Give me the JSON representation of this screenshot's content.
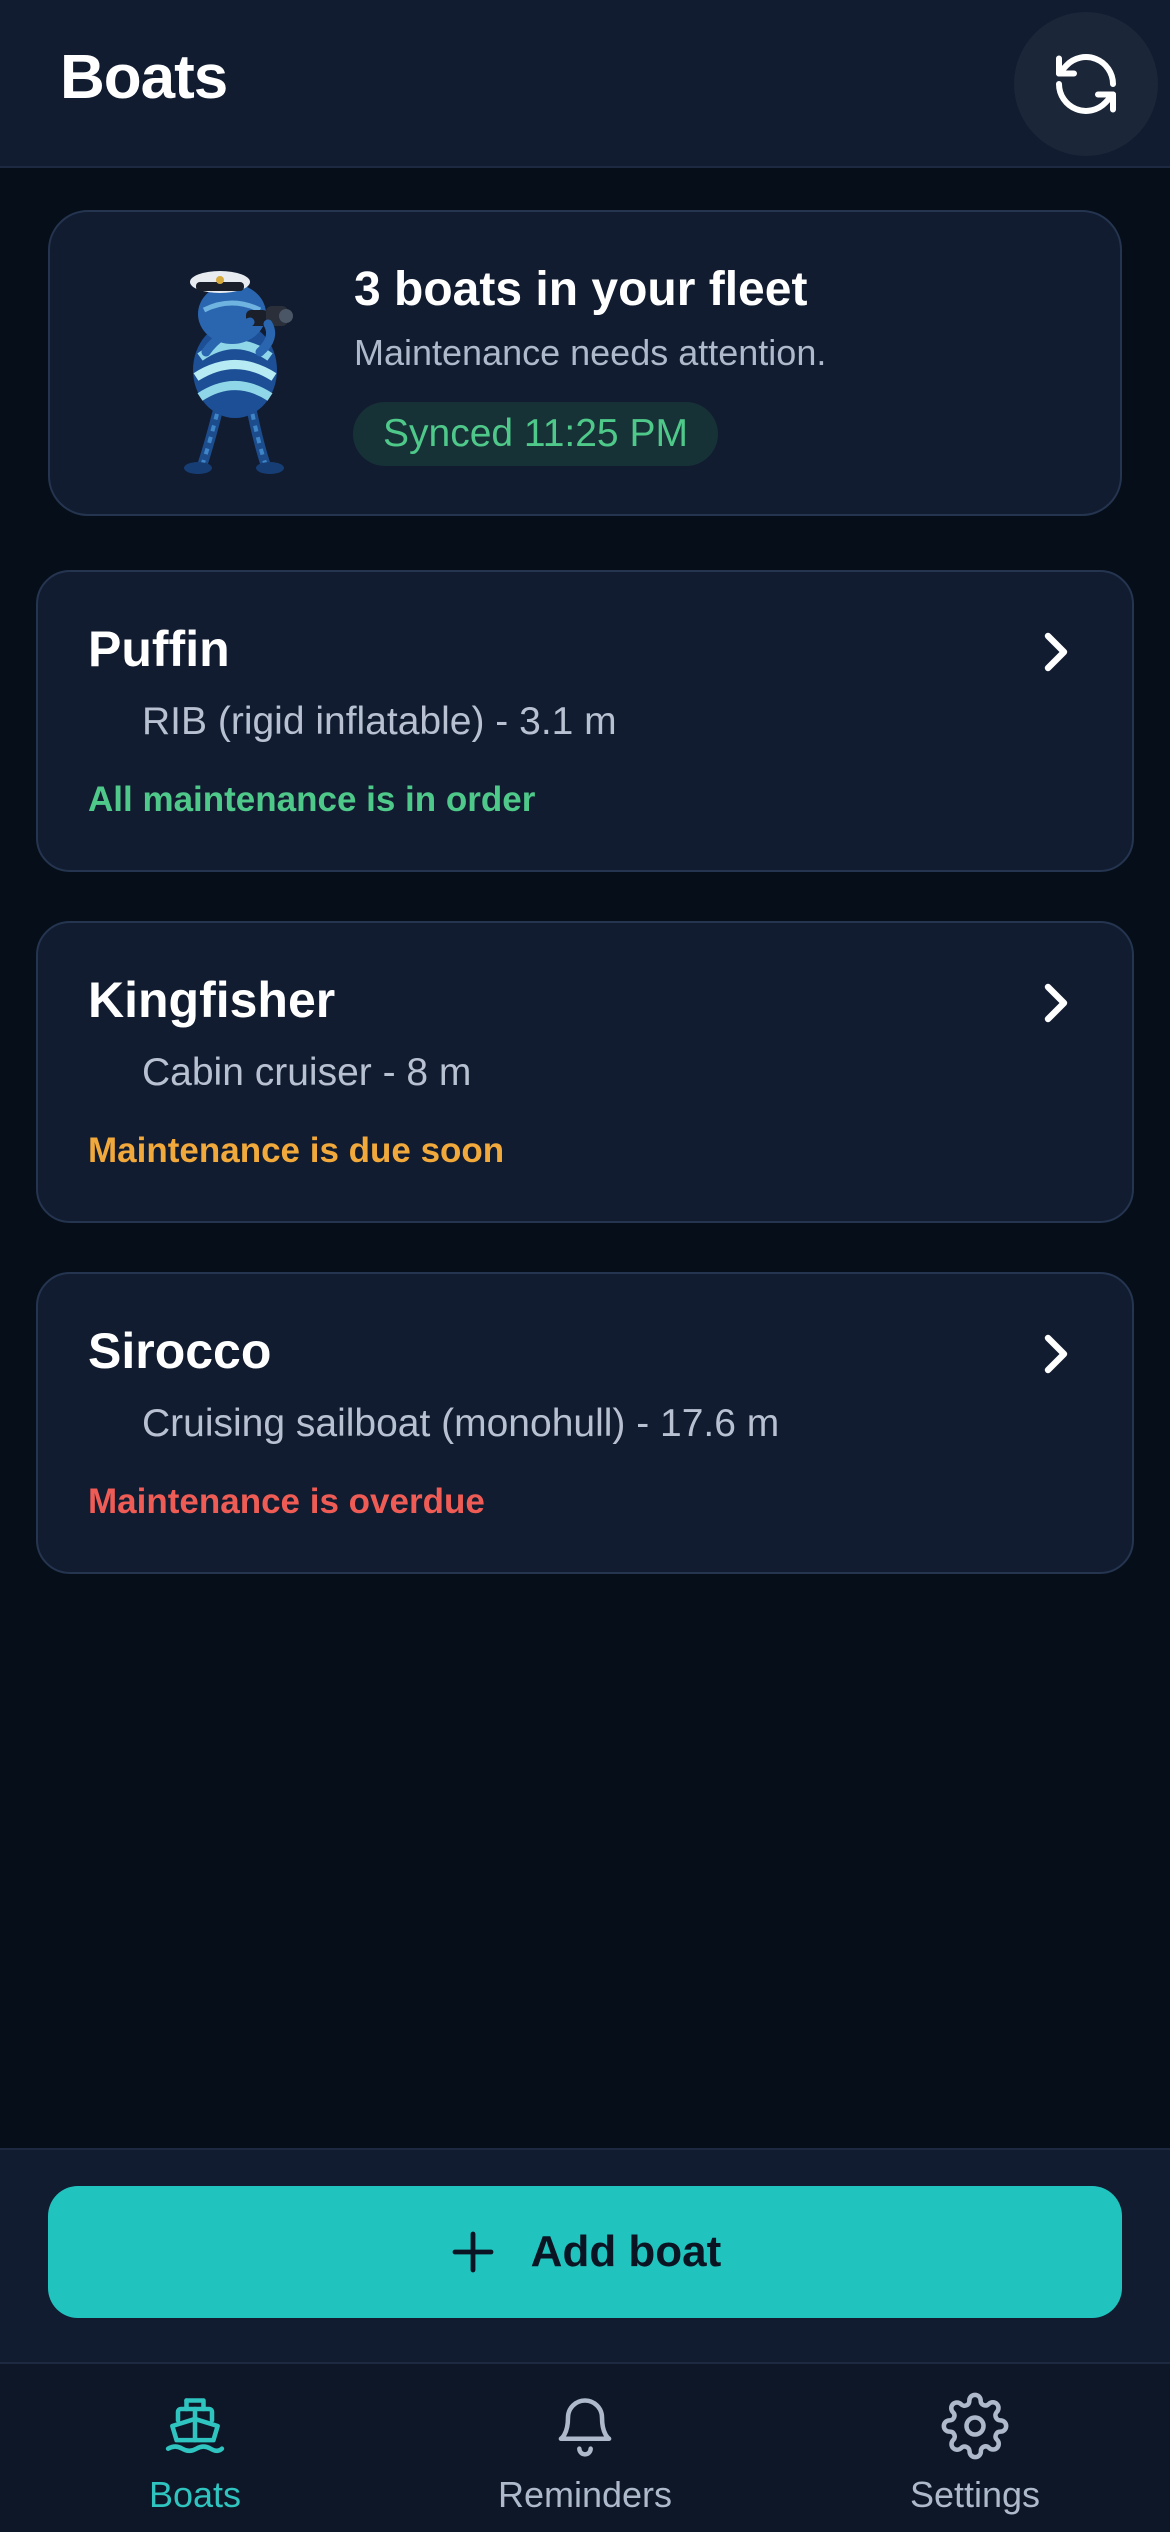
{
  "header": {
    "title": "Boats",
    "sync_icon": "sync-icon"
  },
  "summary": {
    "title": "3 boats in your fleet",
    "subtitle": "Maintenance needs attention.",
    "synced": "Synced 11:25 PM",
    "mascot": "captain-rope-mascot"
  },
  "boats": [
    {
      "name": "Puffin",
      "type": "RIB (rigid inflatable) - 3.1 m",
      "status": "All maintenance is in order",
      "status_color": "#4fc98a"
    },
    {
      "name": "Kingfisher",
      "type": "Cabin cruiser - 8 m",
      "status": "Maintenance is due soon",
      "status_color": "#f2a93b"
    },
    {
      "name": "Sirocco",
      "type": "Cruising sailboat (monohull) - 17.6 m",
      "status": "Maintenance is overdue",
      "status_color": "#ef5c55"
    }
  ],
  "actions": {
    "add_boat": "Add boat"
  },
  "tabs": [
    {
      "label": "Boats",
      "icon": "boat-icon",
      "active": true
    },
    {
      "label": "Reminders",
      "icon": "bell-icon",
      "active": false
    },
    {
      "label": "Settings",
      "icon": "gear-icon",
      "active": false
    }
  ],
  "colors": {
    "accent": "#21c3be",
    "background": "#060e19",
    "card": "#111c30",
    "tab_active": "#2fc4bf",
    "tab_inactive": "#aeb9cb"
  }
}
